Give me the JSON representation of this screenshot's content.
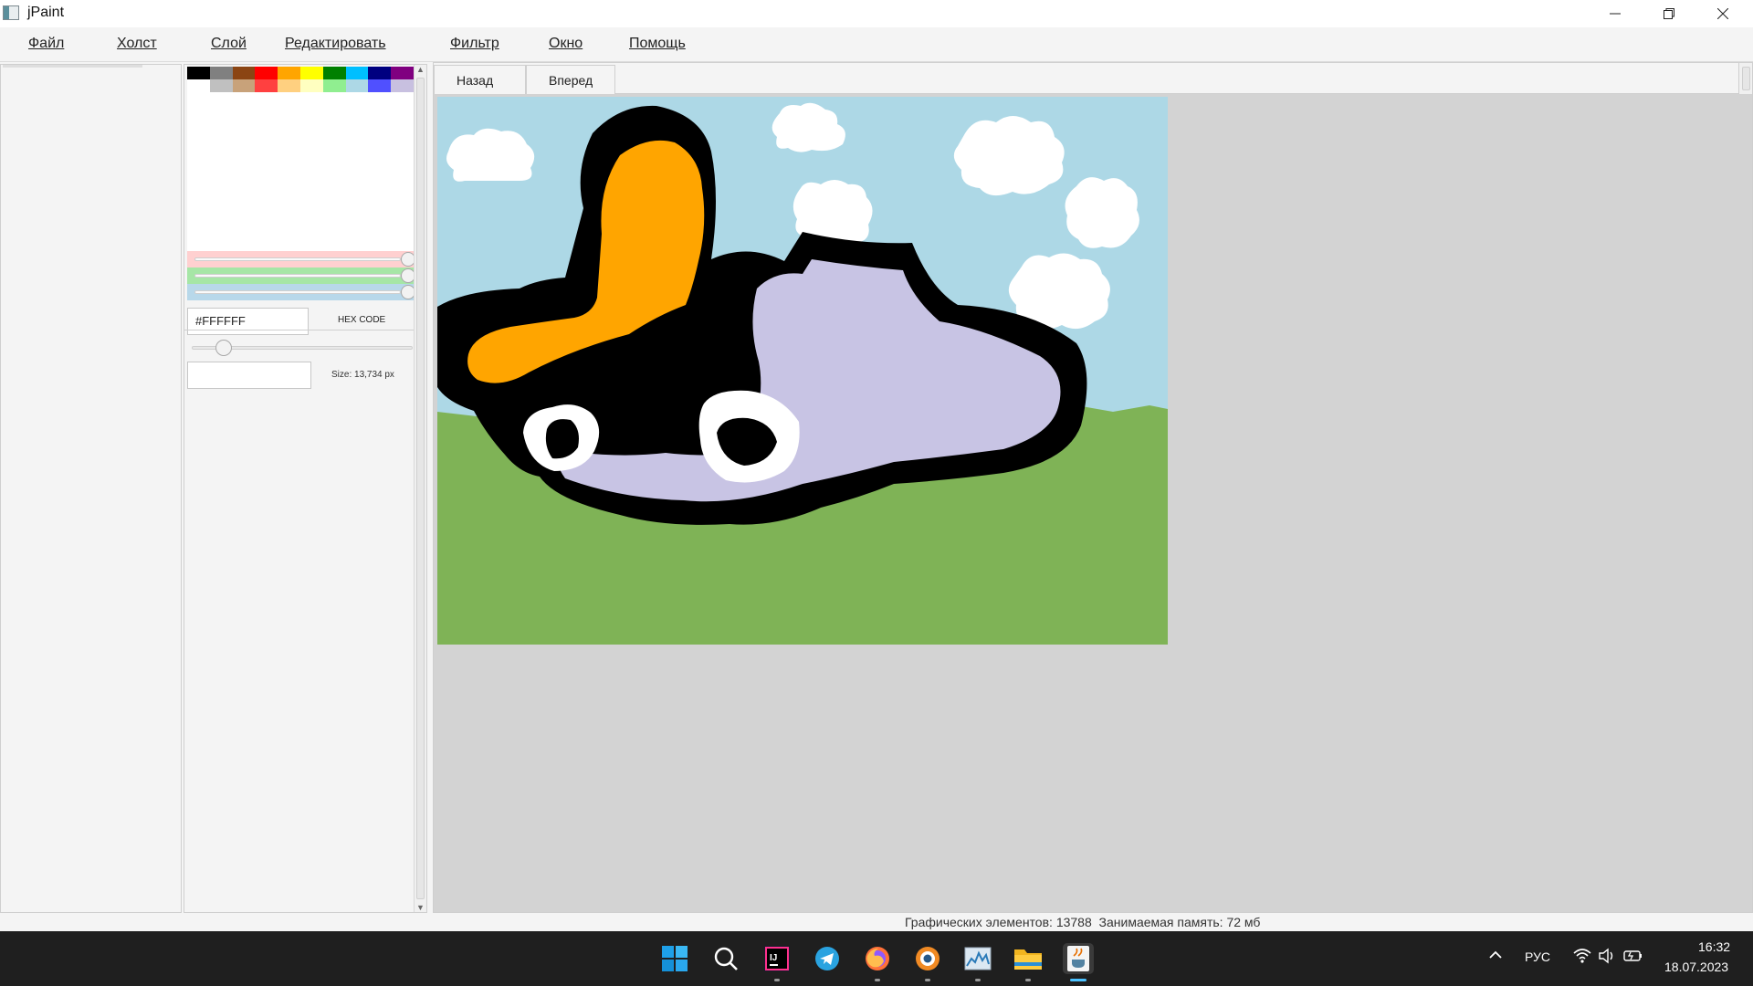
{
  "window": {
    "title": "jPaint"
  },
  "menu": {
    "items": [
      "Файл",
      "Холст",
      "Слой",
      "Редактировать",
      "Фильтр",
      "Окно",
      "Помощь"
    ]
  },
  "palette": {
    "row1": [
      "#000000",
      "#808080",
      "#8b4513",
      "#ff0000",
      "#ffa500",
      "#ffff00",
      "#008000",
      "#00bfff",
      "#000080",
      "#800080"
    ],
    "row2": [
      "#ffffff",
      "#c0c0c0",
      "#c8a27a",
      "#ff4040",
      "#ffd080",
      "#ffffc0",
      "#90ee90",
      "#add8e6",
      "#5050ff",
      "#c8c0e0"
    ]
  },
  "color_picker": {
    "hex_value": "#FFFFFF",
    "hex_label": "HEX CODE",
    "slider_red_color": "#ffd0d0",
    "slider_green_color": "#a6e6a6",
    "slider_blue_color": "#b8d8ea"
  },
  "brush": {
    "size_label": "Size: 13,734 px",
    "size_input_value": ""
  },
  "toolbar": {
    "back_label": "Назад",
    "forward_label": "Вперед"
  },
  "status": {
    "text": "Графических элементов: 13788  Занимаемая память: 72 мб"
  },
  "drawing": {
    "sky_color": "#add8e6",
    "grass_color": "#7fb356",
    "hat_color": "#ffa500",
    "body_color": "#c8c4e4",
    "outline_color": "#000000",
    "cloud_color": "#ffffff"
  },
  "taskbar": {
    "apps": [
      "start-icon",
      "search-icon",
      "intellij-icon",
      "telegram-icon",
      "firefox-icon",
      "blender-icon",
      "stocks-icon",
      "file-explorer-icon",
      "java-icon"
    ],
    "language": "РУС",
    "time": "16:32",
    "date": "18.07.2023"
  }
}
